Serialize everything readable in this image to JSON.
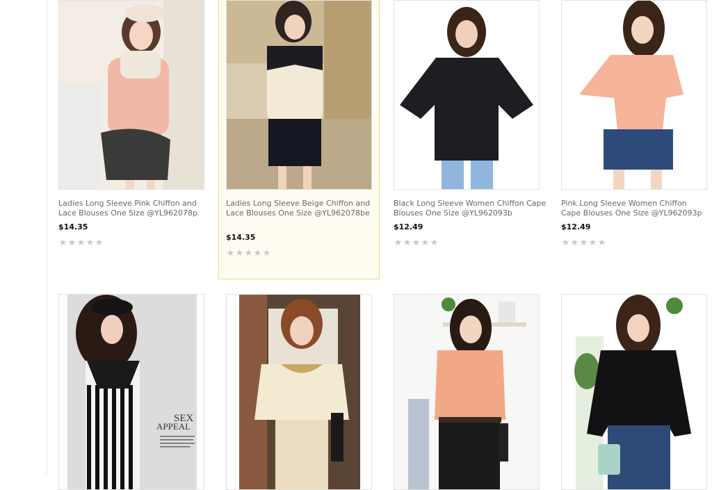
{
  "products": [
    {
      "title": "Ladies Long Sleeve Pink Chiffon and Lace Blouses One Size @YL962078p",
      "price": "$14.35",
      "rating_stars": 0
    },
    {
      "title": "Ladies Long Sleeve Beige Chiffon and Lace Blouses One Size @YL962078be",
      "price": "$14.35",
      "rating_stars": 0
    },
    {
      "title": "Black Long Sleeve Women Chiffon Cape Blouses One Size @YL962093b",
      "price": "$12.49",
      "rating_stars": 0
    },
    {
      "title": "Pink Long Sleeve Women Chiffon Cape Blouses One Size @YL962093p",
      "price": "$12.49",
      "rating_stars": 0
    }
  ],
  "row2_image_text": {
    "line1": "SEX",
    "line2": "APPEAL"
  },
  "colors": {
    "hover_border": "#f0d98a",
    "hover_bg": "#fffdf2",
    "star": "#c9c9c9"
  }
}
